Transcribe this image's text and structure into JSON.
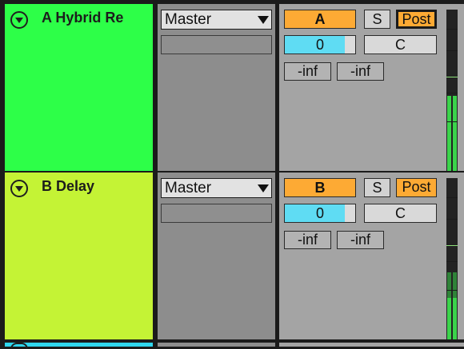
{
  "colors": {
    "track_a": "#2dff48",
    "track_b": "#c4f335",
    "track_next": "#2fd6ee",
    "accent_orange": "#fdaa34",
    "volume_blue": "#5fdcf3",
    "meter_green": "#3bd44b"
  },
  "tracks": [
    {
      "name": "A Hybrid Re",
      "routing": "Master",
      "send_label": "A",
      "solo_label": "S",
      "post_label": "Post",
      "post_outlined": true,
      "volume": "0",
      "volume_fill": 0.85,
      "pan": "C",
      "peak_left": "-inf",
      "peak_right": "-inf"
    },
    {
      "name": "B Delay",
      "routing": "Master",
      "send_label": "B",
      "solo_label": "S",
      "post_label": "Post",
      "post_outlined": false,
      "volume": "0",
      "volume_fill": 0.85,
      "pan": "C",
      "peak_left": "-inf",
      "peak_right": "-inf"
    }
  ],
  "icons": {
    "fold": "fold-triangle-icon",
    "dropdown": "chevron-down-icon"
  }
}
